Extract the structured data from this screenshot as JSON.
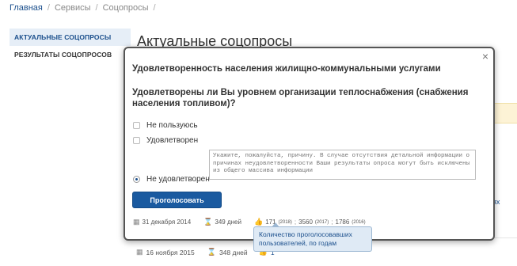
{
  "breadcrumb": {
    "home": "Главная",
    "services": "Сервисы",
    "current": "Соцопросы",
    "sep": "/"
  },
  "sidebar": {
    "items": [
      {
        "label": "АКТУАЛЬНЫЕ СОЦОПРОСЫ"
      },
      {
        "label": "РЕЗУЛЬТАТЫ СОЦОПРОСОВ"
      }
    ]
  },
  "page_title": "Актуальные соцопросы",
  "background": {
    "link_fragment": "ях",
    "meta": {
      "date": "16 ноября 2015",
      "days": "348 дней",
      "votes": "1"
    }
  },
  "modal": {
    "close": "×",
    "title": "Удовлетворенность населения жилищно-коммунальными услугами",
    "question": "Удовлетворены ли Вы уровнем организации теплоснабжения (снабжения населения топливом)?",
    "options": [
      {
        "label": "Не пользуюсь",
        "checked": false
      },
      {
        "label": "Удовлетворен",
        "checked": false
      },
      {
        "label": "Не удовлетворен",
        "checked": true
      }
    ],
    "reason_placeholder": "Укажите, пожалуйста, причину. В случае отсутствия детальной информации о причинах неудовлетворенности Ваши результаты опроса могут быть исключены из общего массива информации",
    "vote_button": "Проголосовать",
    "meta": {
      "date": "31 декабря 2014",
      "days": "349 дней",
      "votes_2018": "171",
      "year_2018": "(2018)",
      "votes_2017": "3560",
      "year_2017": "(2017)",
      "votes_2016": "1786",
      "year_2016": "(2016)",
      "sep": ";"
    }
  },
  "tooltip": "Количество проголосовавших пользователей, по годам",
  "icons": {
    "calendar": "calendar-icon",
    "hourglass": "hourglass-icon",
    "thumbs_up": "thumbs-up-icon"
  },
  "colors": {
    "accent": "#1a5aa0",
    "link": "#1b4f8c",
    "tooltip_bg": "#dfeaf5"
  }
}
